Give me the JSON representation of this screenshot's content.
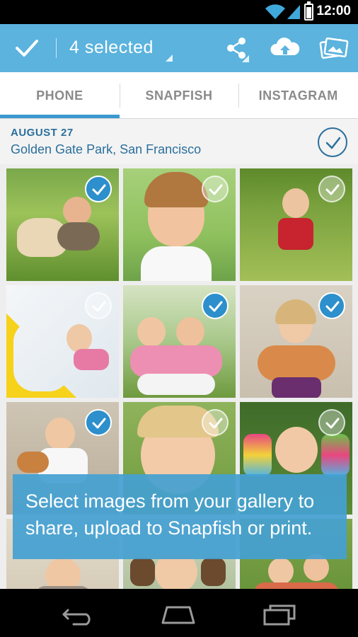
{
  "status_bar": {
    "time": "12:00",
    "icons": [
      "wifi-icon",
      "signal-icon",
      "battery-icon"
    ]
  },
  "action_bar": {
    "title": "4 selected",
    "actions": [
      "share-icon",
      "cloud-upload-icon",
      "photos-icon"
    ]
  },
  "tabs": [
    {
      "label": "PHONE",
      "active": true
    },
    {
      "label": "SNAPFISH",
      "active": false
    },
    {
      "label": "INSTAGRAM",
      "active": false
    }
  ],
  "section": {
    "date": "AUGUST 27",
    "location": "Golden Gate Park, San Francisco"
  },
  "photos": [
    {
      "selected": true,
      "subject": "girl-with-dog"
    },
    {
      "selected": false,
      "subject": "girl-blowing-bubbles"
    },
    {
      "selected": false,
      "subject": "girl-in-flower-field"
    },
    {
      "selected": false,
      "subject": "girl-on-slide"
    },
    {
      "selected": true,
      "subject": "girls-on-grass"
    },
    {
      "selected": true,
      "subject": "girl-with-cats"
    },
    {
      "selected": true,
      "subject": "girl-with-cat-wall"
    },
    {
      "selected": false,
      "subject": "smiling-girl"
    },
    {
      "selected": false,
      "subject": "girl-painted-hands"
    },
    {
      "selected": false,
      "subject": "child-eating"
    },
    {
      "selected": false,
      "subject": "child-muddy-hands"
    },
    {
      "selected": false,
      "subject": "kids-group"
    }
  ],
  "tip": {
    "text": "Select images from your gallery to share, upload to Snapfish or print."
  },
  "nav_bar": {
    "buttons": [
      "back-icon",
      "home-icon",
      "recent-apps-icon"
    ]
  },
  "colors": {
    "action_bar": "#5bb3de",
    "accent": "#3b99cf",
    "header_text": "#2a6f9c",
    "tip_bg": "#45a0d2"
  }
}
